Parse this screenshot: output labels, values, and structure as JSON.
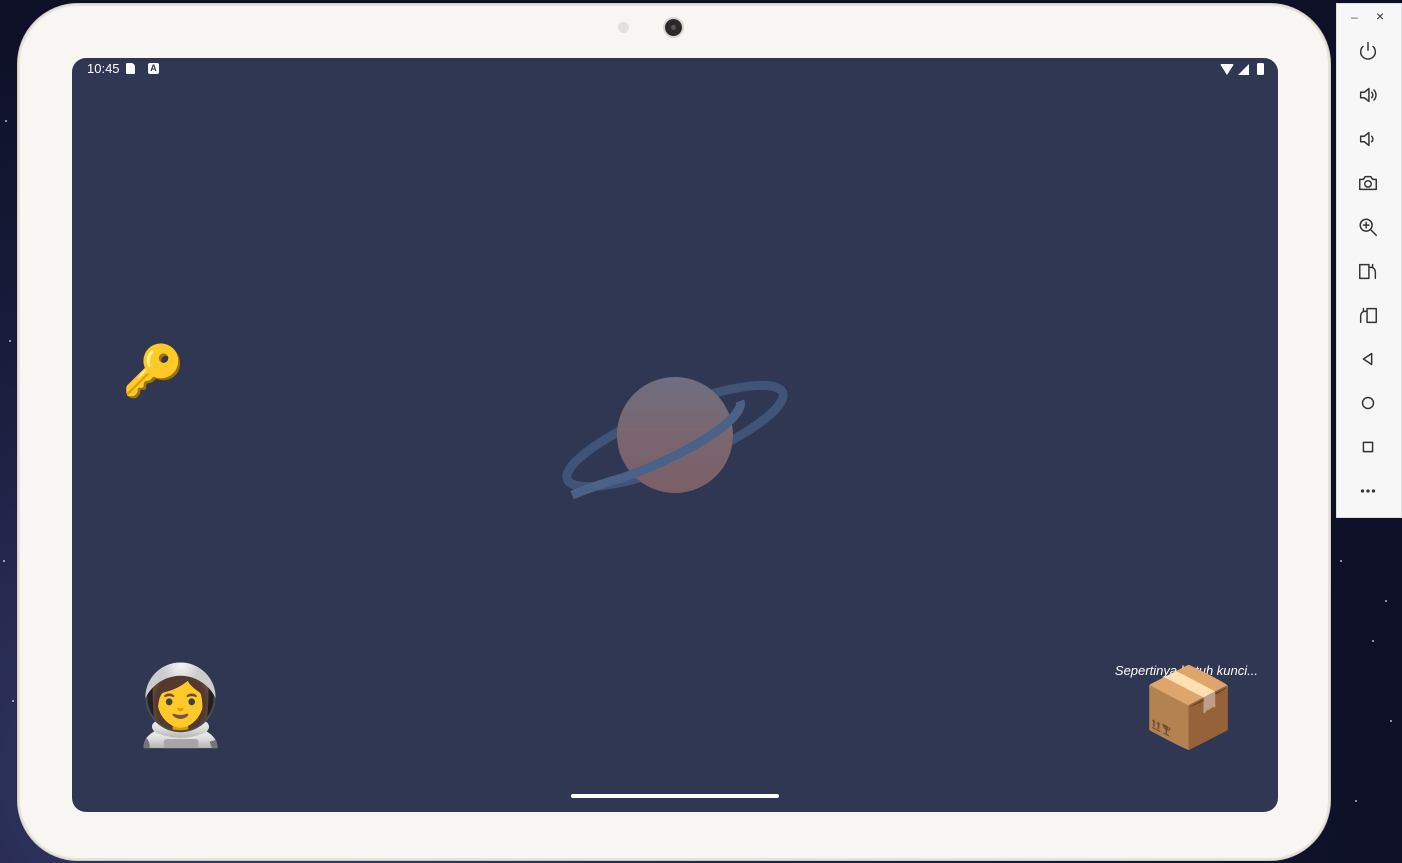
{
  "status_bar": {
    "time": "10:45",
    "a_badge": "A"
  },
  "game": {
    "key_emoji": "🔑",
    "astronaut_emoji": "👩‍🚀",
    "box_emoji": "📦",
    "hint_text": "Sepertinya butuh kunci..."
  },
  "emulator": {
    "minimize_label": "–",
    "close_label": "×",
    "buttons": [
      "power-icon",
      "volume-up-icon",
      "volume-down-icon",
      "camera-icon",
      "zoom-icon",
      "rotate-left-icon",
      "rotate-right-icon",
      "back-icon",
      "home-icon",
      "overview-icon",
      "more-icon"
    ]
  },
  "colors": {
    "screen_bg": "#2f3753",
    "frame": "#f7f6f2"
  }
}
